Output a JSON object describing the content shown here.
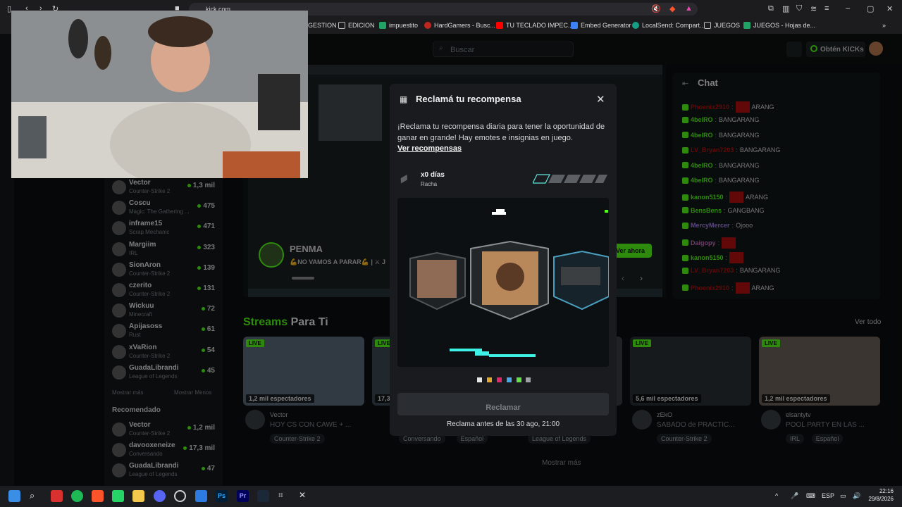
{
  "browser": {
    "url": "kick.com",
    "bookmarks": [
      "GESTION",
      "EDICION",
      "impuestito",
      "HardGamers - Busc...",
      "TU TECLADO IMPEC...",
      "Embed Generator",
      "LocalSend: Compart...",
      "JUEGOS",
      "JUEGOS - Hojas de..."
    ]
  },
  "topbar": {
    "search_placeholder": "Buscar",
    "kicks_label": "Obtén KICKs"
  },
  "sidebar": {
    "following": [
      {
        "name": "Vector",
        "category": "Counter-Strike 2",
        "viewers": "1,3 mil"
      },
      {
        "name": "Coscu",
        "category": "Magic: The Gathering ...",
        "viewers": "475"
      },
      {
        "name": "inframe15",
        "category": "Scrap Mechanic",
        "viewers": "471"
      },
      {
        "name": "Margiim",
        "category": "IRL",
        "viewers": "323"
      },
      {
        "name": "SionAron",
        "category": "Counter-Strike 2",
        "viewers": "139"
      },
      {
        "name": "czerito",
        "category": "Counter-Strike 2",
        "viewers": "131"
      },
      {
        "name": "Wickuu",
        "category": "Minecraft",
        "viewers": "72"
      },
      {
        "name": "Apijasoss",
        "category": "Rust",
        "viewers": "61"
      },
      {
        "name": "xVaRion",
        "category": "Counter-Strike 2",
        "viewers": "54"
      },
      {
        "name": "GuadaLibrandi",
        "category": "League of Legends",
        "viewers": "45"
      }
    ],
    "show_more": "Mostrar más",
    "show_less": "Mostrar Menos",
    "recommended_title": "Recomendado",
    "recommended": [
      {
        "name": "Vector",
        "category": "Counter-Strike 2",
        "viewers": "1,2 mil"
      },
      {
        "name": "davooxeneize",
        "category": "Conversando",
        "viewers": "17,3 mil"
      },
      {
        "name": "GuadaLibrandi",
        "category": "League of Legends",
        "viewers": "47"
      }
    ]
  },
  "hero": {
    "streamer": "PENMA",
    "subtitle": "💪NO VAMOS A PARAR💪 | ⚔ J",
    "cta": "Ver ahora"
  },
  "streams": {
    "title_green": "Streams",
    "title_white": "Para Ti",
    "see_all": "Ver todo",
    "live_label": "LIVE",
    "cards": [
      {
        "viewers": "1,2 mil espectadores",
        "channel": "Vector",
        "title": "HOY CS CON CAWE + ...",
        "tags": [
          "Counter-Strike 2"
        ]
      },
      {
        "viewers": "17,3",
        "channel": "",
        "title": "",
        "tags": [
          "Conversando",
          "Español"
        ]
      },
      {
        "viewers": "",
        "channel": "",
        "title": "",
        "tags": [
          "League of Legends"
        ]
      },
      {
        "viewers": "5,6 mil espectadores",
        "channel": "zEkO",
        "title": "SABADO de PRACTIC...",
        "tags": [
          "Counter-Strike 2"
        ]
      },
      {
        "viewers": "1,2 mil espectadores",
        "channel": "elsantytv",
        "title": "POOL PARTY EN LAS ...",
        "tags": [
          "IRL",
          "Español"
        ]
      }
    ],
    "show_more": "Mostrar más"
  },
  "chat": {
    "title": "Chat",
    "messages": [
      {
        "user": "Phoenix2910",
        "text": "ARANG",
        "color": "#b31010",
        "emote": true
      },
      {
        "user": "4belRO",
        "text": "BANGARANG",
        "color": "#53fc18",
        "emote": false
      },
      {
        "user": "4belRO",
        "text": "BANGARANG",
        "color": "#53fc18",
        "emote": false
      },
      {
        "user": "LV_Bryan7203",
        "text": "BANGARANG",
        "color": "#b31010",
        "emote": false
      },
      {
        "user": "4belRO",
        "text": "BANGARANG",
        "color": "#53fc18",
        "emote": false
      },
      {
        "user": "4belRO",
        "text": "BANGARANG",
        "color": "#53fc18",
        "emote": false
      },
      {
        "user": "kanon5150",
        "text": "ARANG",
        "color": "#53fc18",
        "emote": true
      },
      {
        "user": "BensBens",
        "text": "GANGBANG",
        "color": "#53fc18",
        "emote": false
      },
      {
        "user": "MercyMercer",
        "text": "Ojooo",
        "color": "#a582e8",
        "emote": false
      },
      {
        "user": "Daigopy",
        "text": "",
        "color": "#c86fbf",
        "emote": true
      },
      {
        "user": "kanon5150",
        "text": "",
        "color": "#53fc18",
        "emote": true
      },
      {
        "user": "LV_Bryan7203",
        "text": "BANGARANG",
        "color": "#b31010",
        "emote": false
      },
      {
        "user": "Phoenix2910",
        "text": "ARANG",
        "color": "#b31010",
        "emote": true
      }
    ]
  },
  "modal": {
    "title": "Reclamá tu recompensa",
    "description": "¡Reclama tu recompensa diaria para tener la oportunidad de ganar en grande! Hay emotes e insignias en juego.",
    "see_rewards": "Ver recompensas",
    "streak_value": "x0 días",
    "streak_label": "Racha",
    "claim_button": "Reclamar",
    "deadline": "Reclama antes de las 30 ago, 21:00"
  },
  "taskbar": {
    "lang": "ESP",
    "time": "22:16",
    "date": "29/8/2026"
  }
}
